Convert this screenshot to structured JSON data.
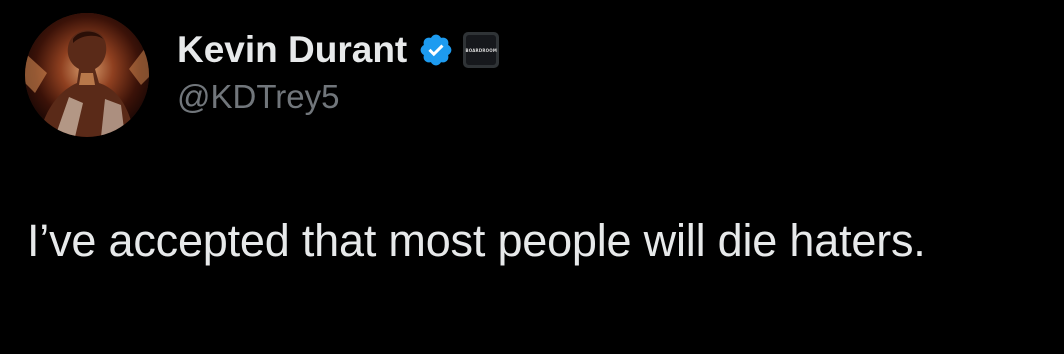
{
  "author": {
    "display_name": "Kevin Durant",
    "handle": "@KDTrey5",
    "verified": true,
    "verified_color": "#1d9bf0",
    "affiliate_badge_text": "BOARDROOM"
  },
  "tweet": {
    "text": "I’ve accepted that most people will die haters."
  },
  "theme": {
    "background": "#000000",
    "primary_text": "#e7e9ea",
    "secondary_text": "#71767b"
  },
  "icons": {
    "avatar": "profile-photo",
    "verified": "verified-badge-icon",
    "affiliate": "boardroom-affiliate-icon"
  }
}
